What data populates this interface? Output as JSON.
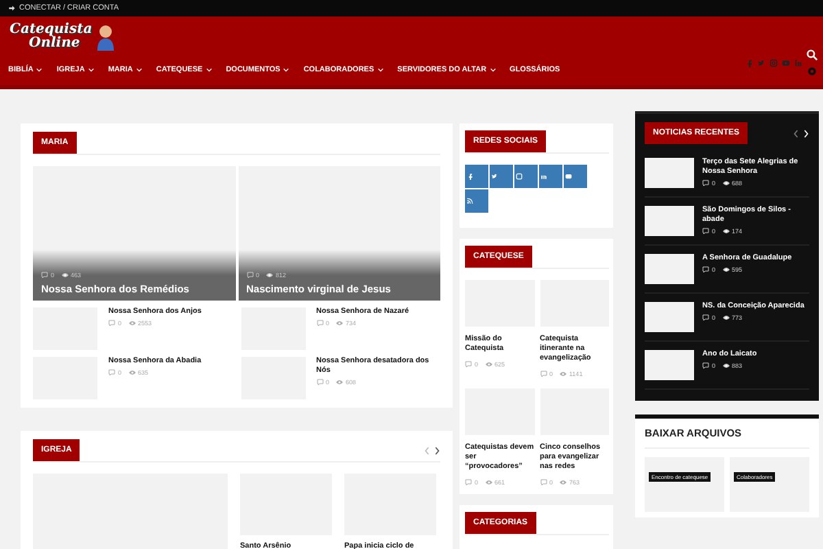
{
  "top_bar": {
    "login": "CONECTAR / CRIAR CONTA"
  },
  "header": {
    "logo": [
      "Catequista",
      "Online"
    ],
    "nav": [
      {
        "label": "BIBLÍA",
        "dropdown": true
      },
      {
        "label": "IGREJA",
        "dropdown": true
      },
      {
        "label": "MARIA",
        "dropdown": true
      },
      {
        "label": "CATEQUESE",
        "dropdown": true
      },
      {
        "label": "DOCUMENTOS",
        "dropdown": true
      },
      {
        "label": "COLABORADORES",
        "dropdown": true
      },
      {
        "label": "SERVIDORES DO ALTAR",
        "dropdown": true
      },
      {
        "label": "GLOSSÁRIOS",
        "dropdown": false
      }
    ]
  },
  "maria": {
    "title": "MARIA",
    "featured": [
      {
        "title": "Nossa Senhora dos Remédios",
        "comments": "0",
        "views": "463"
      },
      {
        "title": "Nascimento virginal de Jesus",
        "comments": "0",
        "views": "812"
      }
    ],
    "posts": [
      {
        "title": "Nossa Senhora dos Anjos",
        "comments": "0",
        "views": "2553"
      },
      {
        "title": "Nossa Senhora de Nazaré",
        "comments": "0",
        "views": "734"
      },
      {
        "title": "Nossa Senhora da Abadia",
        "comments": "0",
        "views": "635"
      },
      {
        "title": "Nossa Senhora desatadora dos Nós",
        "comments": "0",
        "views": "608"
      }
    ]
  },
  "igreja": {
    "title": "IGREJA",
    "posts": [
      {
        "title": "Santo Arsênio"
      },
      {
        "title": "Papa inicia ciclo de"
      }
    ]
  },
  "redes_sociais": {
    "title": "REDES SOCIAIS"
  },
  "catequese": {
    "title": "CATEQUESE",
    "posts": [
      {
        "title": "Missão do Catequista",
        "comments": "0",
        "views": "625"
      },
      {
        "title": "Catequista itinerante na evangelização",
        "comments": "0",
        "views": "1141"
      },
      {
        "title": "Catequistas devem ser “provocadores”",
        "comments": "0",
        "views": "661"
      },
      {
        "title": "Cinco conselhos para evangelizar nas redes",
        "comments": "0",
        "views": "763"
      }
    ]
  },
  "categorias": {
    "title": "CATEGORIAS"
  },
  "noticias_recentes": {
    "title": "NOTICIAS RECENTES",
    "posts": [
      {
        "title": "Terço das Sete Alegrias de Nossa Senhora",
        "comments": "0",
        "views": "688"
      },
      {
        "title": "São Domingos de Silos - abade",
        "comments": "0",
        "views": "174"
      },
      {
        "title": "A Senhora de Guadalupe",
        "comments": "0",
        "views": "595"
      },
      {
        "title": "NS. da Conceição Aparecida",
        "comments": "0",
        "views": "773"
      },
      {
        "title": "Ano do Laicato",
        "comments": "0",
        "views": "883"
      }
    ]
  },
  "baixar_arquivos": {
    "title": "BAIXAR ARQUIVOS",
    "items": [
      {
        "tag": "Encontro de catequese"
      },
      {
        "tag": "Colaboradores"
      }
    ]
  }
}
